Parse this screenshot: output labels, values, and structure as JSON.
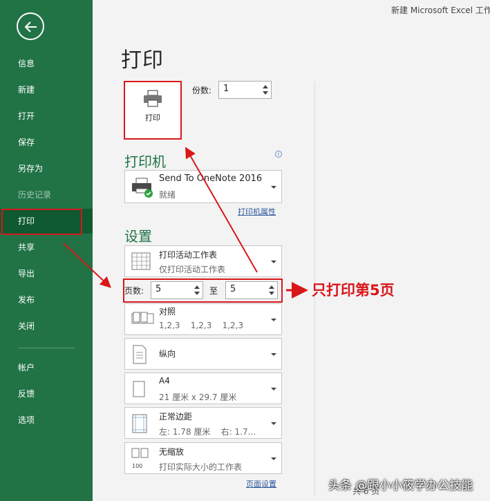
{
  "window": {
    "title": "新建 Microsoft Excel 工作"
  },
  "sidebar": {
    "items": [
      {
        "label": "信息"
      },
      {
        "label": "新建"
      },
      {
        "label": "打开"
      },
      {
        "label": "保存"
      },
      {
        "label": "另存为"
      },
      {
        "label": "历史记录"
      },
      {
        "label": "打印"
      },
      {
        "label": "共享"
      },
      {
        "label": "导出"
      },
      {
        "label": "发布"
      },
      {
        "label": "关闭"
      },
      {
        "label": "帐户"
      },
      {
        "label": "反馈"
      },
      {
        "label": "选项"
      }
    ]
  },
  "main": {
    "title": "打印",
    "print_button": "打印",
    "copies": {
      "label": "份数:",
      "value": "1"
    },
    "printer": {
      "heading": "打印机",
      "name": "Send To OneNote 2016",
      "status": "就绪",
      "properties_link": "打印机属性"
    },
    "settings": {
      "heading": "设置",
      "scope": {
        "title": "打印活动工作表",
        "subtitle": "仅打印活动工作表"
      },
      "pages": {
        "label": "页数:",
        "from": "5",
        "to_label": "至",
        "to": "5"
      },
      "collate": {
        "title": "对照",
        "subtitle": "1,2,3    1,2,3    1,2,3"
      },
      "orientation": {
        "title": "纵向"
      },
      "paper": {
        "title": "A4",
        "subtitle": "21 厘米 x 29.7 厘米"
      },
      "margins": {
        "title": "正常边距",
        "subtitle": "左: 1.78 厘米    右: 1.7..."
      },
      "scaling": {
        "title": "无缩放",
        "subtitle": "打印实际大小的工作表"
      },
      "page_setup_link": "页面设置"
    }
  },
  "annotation": {
    "text": "只打印第5页"
  },
  "watermark": {
    "text": "头条 @跟小小筱学办公技能"
  },
  "pager": {
    "text": "共 6 页"
  },
  "colors": {
    "accent": "#217346",
    "annotation": "#d9161a",
    "link": "#2b579a"
  }
}
